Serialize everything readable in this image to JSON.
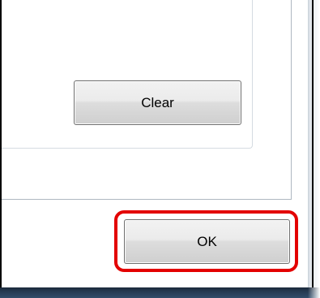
{
  "dialog": {
    "clear_button_label": "Clear",
    "ok_button_label": "OK"
  },
  "colors": {
    "highlight_ring": "#e30000",
    "taskbar": "#263a52"
  }
}
